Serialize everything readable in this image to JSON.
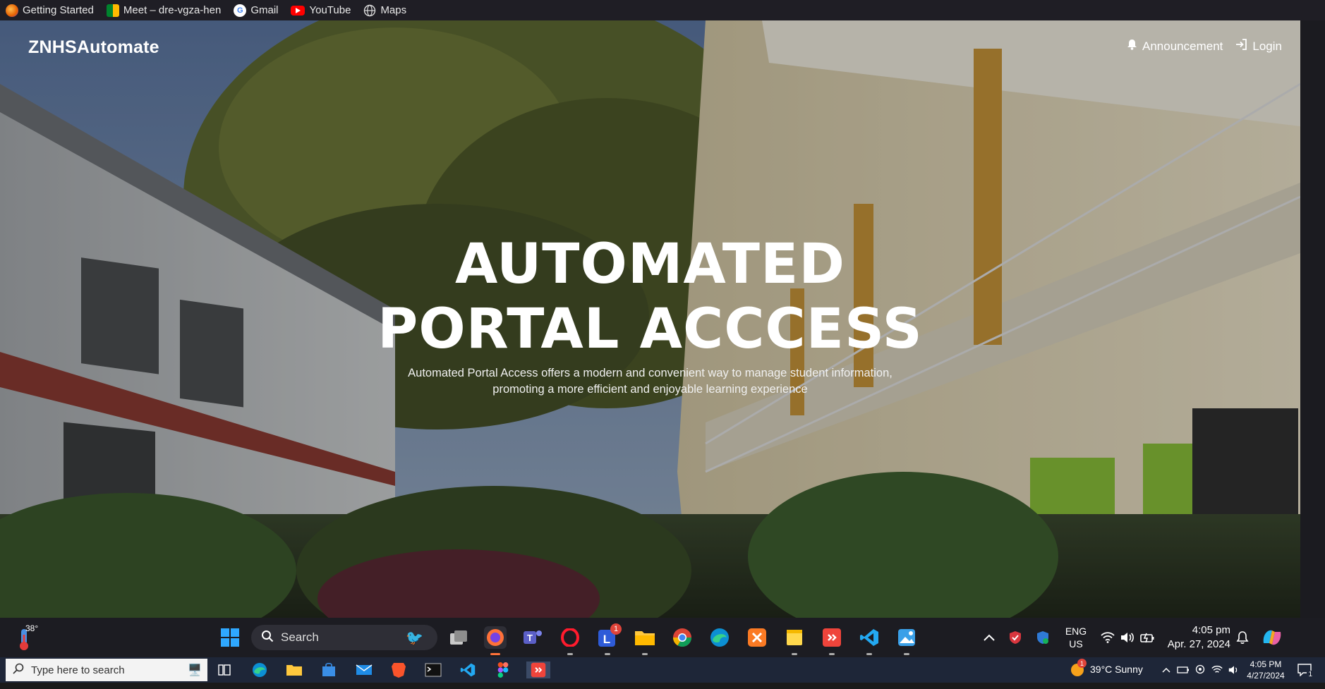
{
  "bookmarks": [
    {
      "label": "Getting Started",
      "icon": "firefox-icon"
    },
    {
      "label": "Meet – dre-vgza-hen",
      "icon": "google-meet-icon"
    },
    {
      "label": "Gmail",
      "icon": "google-icon"
    },
    {
      "label": "YouTube",
      "icon": "youtube-icon"
    },
    {
      "label": "Maps",
      "icon": "globe-icon"
    }
  ],
  "site": {
    "brand": "ZNHSAutomate",
    "nav": {
      "announcement": "Announcement",
      "login": "Login"
    },
    "hero": {
      "title_line1": "AUTOMATED",
      "title_line2": "PORTAL ACCCESS",
      "subtitle_line1": "Automated Portal Access offers a modern and convenient way to manage student information,",
      "subtitle_line2": "promoting a more efficient and enjoyable learning experience"
    }
  },
  "taskbar_top": {
    "weather_temp": "38°",
    "search_label": "Search",
    "lang_line1": "ENG",
    "lang_line2": "US",
    "time": "4:05 pm",
    "date": "Apr. 27, 2024",
    "teams_badge": "1"
  },
  "taskbar_bottom": {
    "search_placeholder": "Type here to search",
    "weather": "39°C  Sunny",
    "weather_badge": "1",
    "time": "4:05 PM",
    "date": "4/27/2024",
    "notification_count": "1"
  },
  "colors": {
    "bookmark_bar": "#1f1e25",
    "taskbar_win11": "#1c1c22",
    "taskbar_win10": "#1e2638"
  }
}
